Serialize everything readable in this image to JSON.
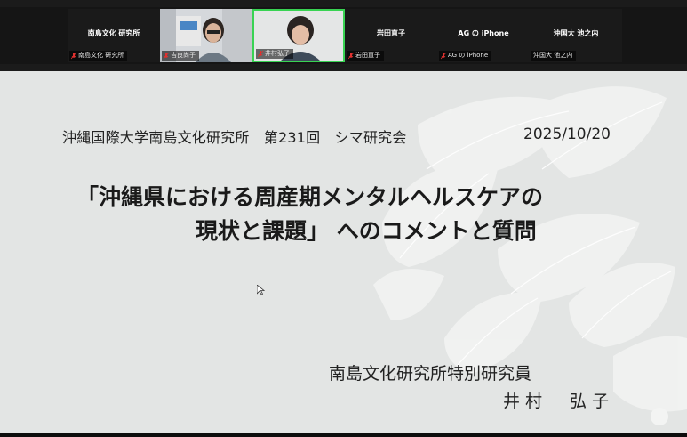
{
  "participants": [
    {
      "display_name": "南島文化 研究所",
      "tag": "南島文化 研究所",
      "video": false
    },
    {
      "display_name": "",
      "tag": "吉良尚子",
      "video": true
    },
    {
      "display_name": "",
      "tag": "井村弘子",
      "video": true,
      "active_speaker": true
    },
    {
      "display_name": "岩田直子",
      "tag": "岩田直子",
      "video": false
    },
    {
      "display_name": "AG の iPhone",
      "tag": "AG の iPhone",
      "video": false
    },
    {
      "display_name": "沖国大 池之内",
      "tag": "沖国大 池之内",
      "video": false
    }
  ],
  "slide": {
    "header_left": "沖縄国際大学南島文化研究所　第231回　シマ研究会",
    "header_date": "2025/10/20",
    "title_line1": "「沖縄県における周産期メンタルヘルスケアの",
    "title_line2": "現状と課題」 へのコメントと質問",
    "affiliation": "南島文化研究所特別研究員",
    "presenter": "井村　弘子"
  },
  "colors": {
    "active_speaker_border": "#39d353",
    "slide_background": "#e3e5e4",
    "mute_icon": "#e0312f"
  }
}
